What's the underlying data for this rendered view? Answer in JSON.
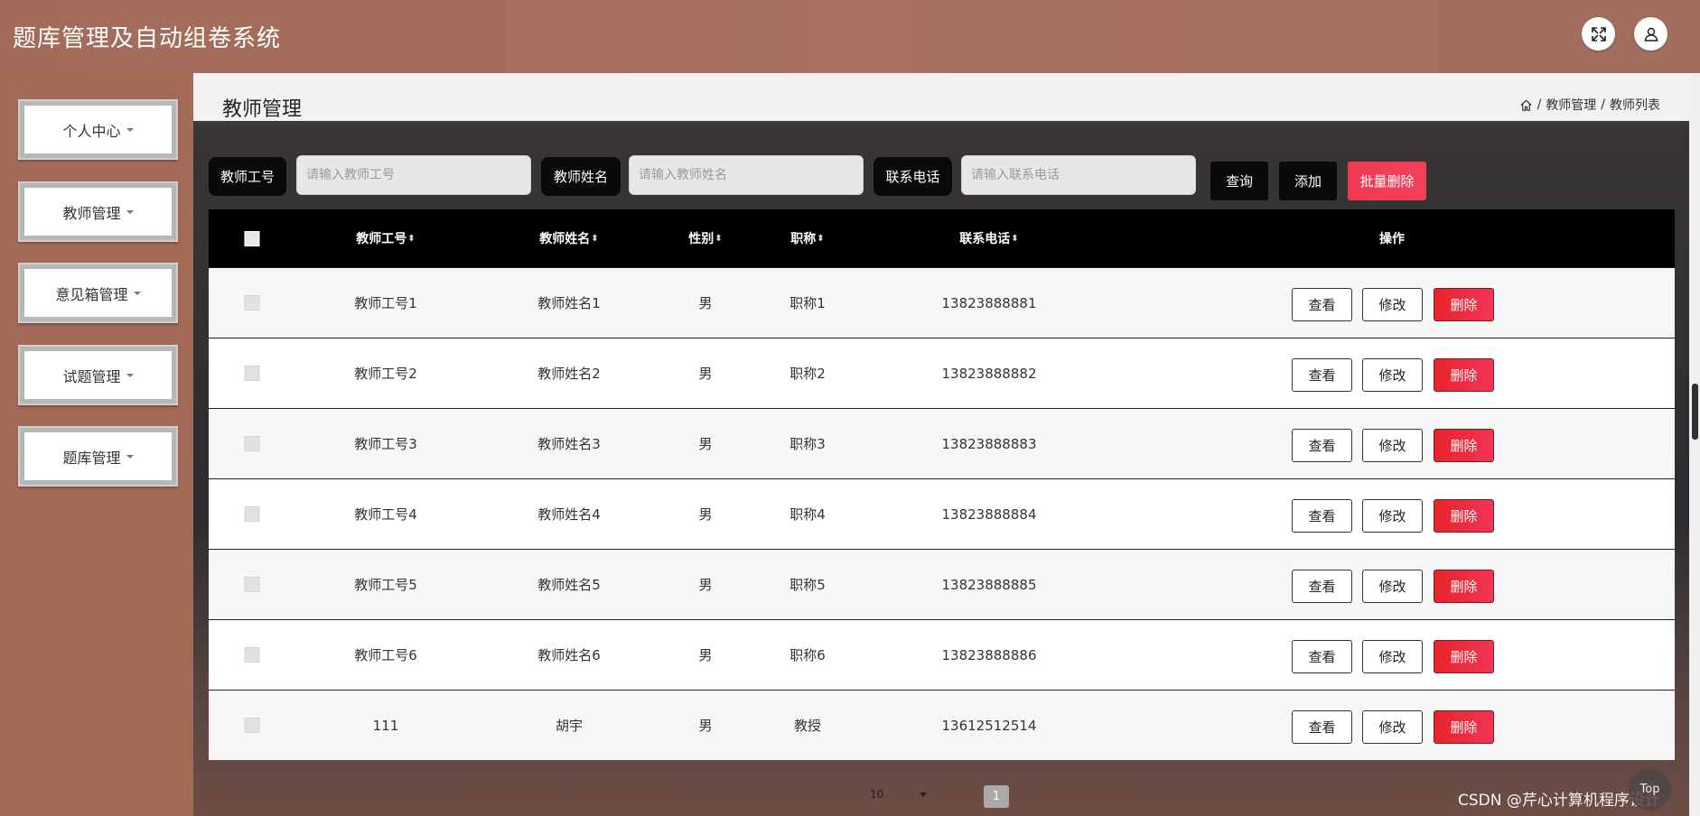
{
  "app": {
    "title": "题库管理及自动组卷系统"
  },
  "header": {
    "fullscreen_icon": "expand-icon",
    "user_icon": "user-icon"
  },
  "sidebar": {
    "items": [
      {
        "label": "个人中心"
      },
      {
        "label": "教师管理"
      },
      {
        "label": "意见箱管理"
      },
      {
        "label": "试题管理"
      },
      {
        "label": "题库管理"
      }
    ]
  },
  "page": {
    "title": "教师管理",
    "breadcrumb": {
      "sep": "/",
      "level1": "教师管理",
      "level2": "教师列表"
    }
  },
  "search": {
    "teacher_no_label": "教师工号",
    "teacher_no_placeholder": "请输入教师工号",
    "teacher_name_label": "教师姓名",
    "teacher_name_placeholder": "请输入教师姓名",
    "phone_label": "联系电话",
    "phone_placeholder": "请输入联系电话",
    "query_label": "查询",
    "add_label": "添加",
    "batch_delete_label": "批量删除"
  },
  "table": {
    "headers": {
      "teacher_no": "教师工号",
      "teacher_name": "教师姓名",
      "gender": "性别",
      "title": "职称",
      "phone": "联系电话",
      "actions": "操作",
      "sort_glyph": "⬍"
    },
    "action_labels": {
      "view": "查看",
      "edit": "修改",
      "delete": "删除"
    },
    "rows": [
      {
        "teacher_no": "教师工号1",
        "teacher_name": "教师姓名1",
        "gender": "男",
        "title": "职称1",
        "phone": "13823888881"
      },
      {
        "teacher_no": "教师工号2",
        "teacher_name": "教师姓名2",
        "gender": "男",
        "title": "职称2",
        "phone": "13823888882"
      },
      {
        "teacher_no": "教师工号3",
        "teacher_name": "教师姓名3",
        "gender": "男",
        "title": "职称3",
        "phone": "13823888883"
      },
      {
        "teacher_no": "教师工号4",
        "teacher_name": "教师姓名4",
        "gender": "男",
        "title": "职称4",
        "phone": "13823888884"
      },
      {
        "teacher_no": "教师工号5",
        "teacher_name": "教师姓名5",
        "gender": "男",
        "title": "职称5",
        "phone": "13823888885"
      },
      {
        "teacher_no": "教师工号6",
        "teacher_name": "教师姓名6",
        "gender": "男",
        "title": "职称6",
        "phone": "13823888886"
      },
      {
        "teacher_no": "111",
        "teacher_name": "胡宇",
        "gender": "男",
        "title": "教授",
        "phone": "13612512514"
      }
    ]
  },
  "pagination": {
    "page_size": "10",
    "current_page": "1"
  },
  "misc": {
    "back_to_top": "Top",
    "watermark": "CSDN @芹心计算机程序设计"
  },
  "colors": {
    "header_bg": "#a36b59",
    "sidebar_bg": "#a56b59",
    "table_head_bg": "#000000",
    "delete_red": "#e8232c",
    "batch_delete_red": "#f13b55"
  }
}
